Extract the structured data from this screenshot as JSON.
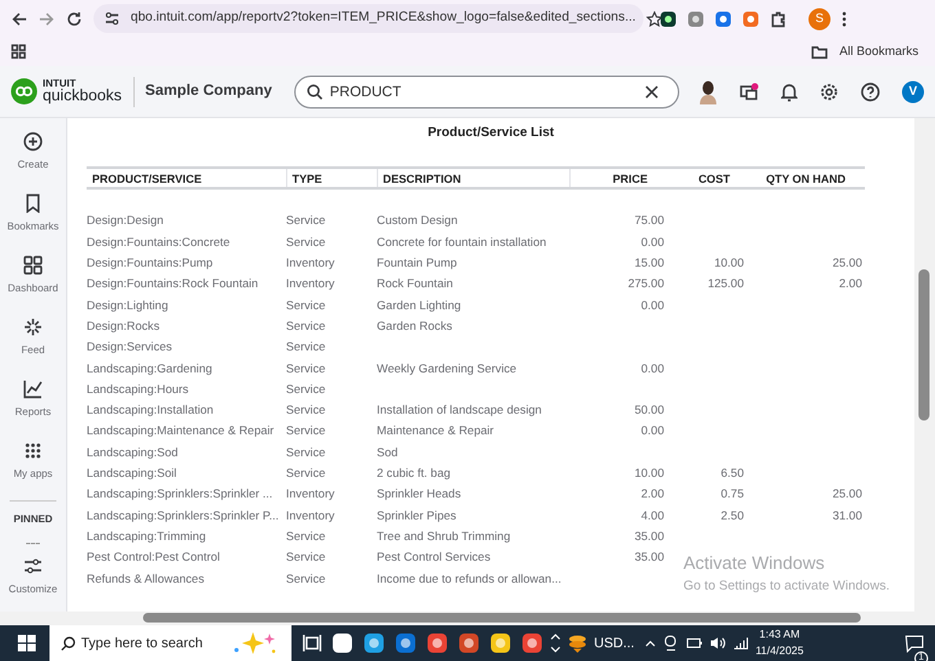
{
  "browser": {
    "url": "qbo.intuit.com/app/reportv2?token=ITEM_PRICE&show_logo=false&edited_sections...",
    "bookmarks_label": "All Bookmarks",
    "profile_initial": "S"
  },
  "app": {
    "logo_top": "INTUIT",
    "logo_bottom": "quickbooks",
    "company": "Sample Company",
    "search": {
      "value": "PRODUCT"
    },
    "avatar_initial": "V"
  },
  "sidebar": {
    "items": [
      {
        "kind": "create",
        "label": "Create"
      },
      {
        "kind": "bookmarks",
        "label": "Bookmarks"
      },
      {
        "kind": "dashboard",
        "label": "Dashboard"
      },
      {
        "kind": "feed",
        "label": "Feed"
      },
      {
        "kind": "reports",
        "label": "Reports"
      },
      {
        "kind": "apps",
        "label": "My apps"
      }
    ],
    "pinned_label": "PINNED",
    "customize": {
      "label": "Customize"
    }
  },
  "report": {
    "title": "Product/Service List",
    "columns": [
      "PRODUCT/SERVICE",
      "TYPE",
      "DESCRIPTION",
      "PRICE",
      "COST",
      "QTY ON HAND"
    ],
    "rows": [
      [
        "Design:Design",
        "Service",
        "Custom Design",
        "75.00",
        "",
        ""
      ],
      [
        "Design:Fountains:Concrete",
        "Service",
        "Concrete for fountain installation",
        "0.00",
        "",
        ""
      ],
      [
        "Design:Fountains:Pump",
        "Inventory",
        "Fountain Pump",
        "15.00",
        "10.00",
        "25.00"
      ],
      [
        "Design:Fountains:Rock Fountain",
        "Inventory",
        "Rock Fountain",
        "275.00",
        "125.00",
        "2.00"
      ],
      [
        "Design:Lighting",
        "Service",
        "Garden Lighting",
        "0.00",
        "",
        ""
      ],
      [
        "Design:Rocks",
        "Service",
        "Garden Rocks",
        "",
        "",
        ""
      ],
      [
        "Design:Services",
        "Service",
        "",
        "",
        "",
        ""
      ],
      [
        "Landscaping:Gardening",
        "Service",
        "Weekly Gardening Service",
        "0.00",
        "",
        ""
      ],
      [
        "Landscaping:Hours",
        "Service",
        "",
        "",
        "",
        ""
      ],
      [
        "Landscaping:Installation",
        "Service",
        "Installation of landscape design",
        "50.00",
        "",
        ""
      ],
      [
        "Landscaping:Maintenance & Repair",
        "Service",
        "Maintenance & Repair",
        "0.00",
        "",
        ""
      ],
      [
        "Landscaping:Sod",
        "Service",
        "Sod",
        "",
        "",
        ""
      ],
      [
        "Landscaping:Soil",
        "Service",
        "2 cubic ft. bag",
        "10.00",
        "6.50",
        ""
      ],
      [
        "Landscaping:Sprinklers:Sprinkler ...",
        "Inventory",
        "Sprinkler Heads",
        "2.00",
        "0.75",
        "25.00"
      ],
      [
        "Landscaping:Sprinklers:Sprinkler P...",
        "Inventory",
        "Sprinkler Pipes",
        "4.00",
        "2.50",
        "31.00"
      ],
      [
        "Landscaping:Trimming",
        "Service",
        "Tree and Shrub Trimming",
        "35.00",
        "",
        ""
      ],
      [
        "Pest Control:Pest Control",
        "Service",
        "Pest Control Services",
        "35.00",
        "",
        ""
      ],
      [
        "Refunds & Allowances",
        "Service",
        "Income due to refunds or allowan...",
        "",
        "",
        ""
      ]
    ]
  },
  "os_overlay": {
    "title": "Activate Windows",
    "subtitle": "Go to Settings to activate Windows."
  },
  "taskbar": {
    "search_placeholder": "Type here to search",
    "tray_app": "USD...",
    "time": "1:43 AM",
    "date": "11/4/2025",
    "notification_count": "1"
  }
}
